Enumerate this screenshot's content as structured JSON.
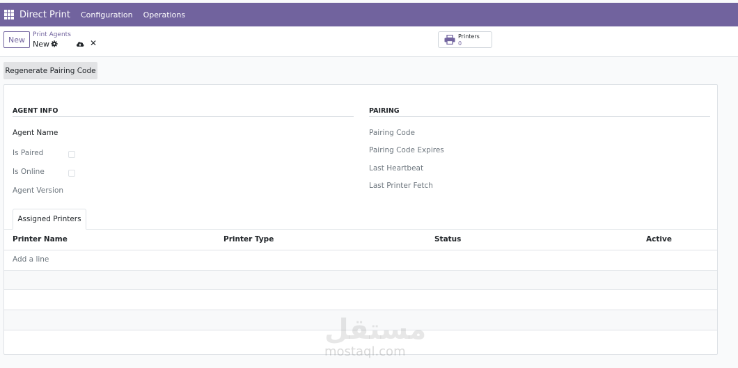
{
  "navbar": {
    "app_name": "Direct Print",
    "menu": [
      "Configuration",
      "Operations"
    ],
    "apps_icon": "apps-grid-icon"
  },
  "control_panel": {
    "new_label": "New",
    "breadcrumb_parent": "Print Agents",
    "breadcrumb_current": "New",
    "icons": [
      "gear-icon",
      "cloud-upload-icon",
      "close-icon"
    ],
    "stat_button": {
      "label": "Printers",
      "value": "0",
      "icon": "printer-icon"
    }
  },
  "actions": {
    "regenerate_label": "Regenerate Pairing Code"
  },
  "form": {
    "agent_info": {
      "title": "AGENT INFO",
      "agent_name": "Agent Name",
      "is_paired": "Is Paired",
      "is_online": "Is Online",
      "agent_version": "Agent Version"
    },
    "pairing": {
      "title": "PAIRING",
      "pairing_code": "Pairing Code",
      "pairing_code_expires": "Pairing Code Expires",
      "last_heartbeat": "Last Heartbeat",
      "last_printer_fetch": "Last Printer Fetch"
    },
    "tab": {
      "label": "Assigned Printers"
    },
    "table": {
      "columns": [
        "Printer Name",
        "Printer Type",
        "Status",
        "Active"
      ],
      "add_line": "Add a line"
    }
  },
  "watermark": {
    "arabic": "مستقل",
    "latin": "mostaql.com"
  },
  "colors": {
    "brand": "#71639e",
    "border": "#dee2e6",
    "muted_text": "#6c757d"
  }
}
